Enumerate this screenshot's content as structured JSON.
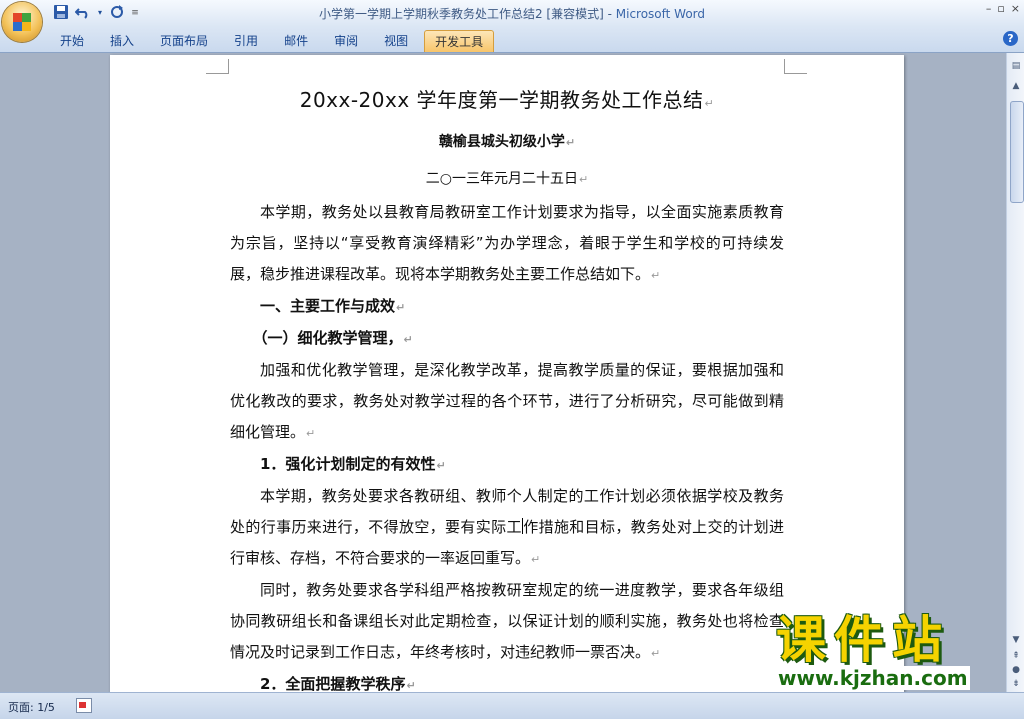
{
  "window": {
    "title": "小学第一学期上学期秋季教务处工作总结2 [兼容模式] - ",
    "app_name": "Microsoft Word",
    "controls": [
      "–",
      "▫",
      "×"
    ]
  },
  "ribbon": {
    "tabs": [
      {
        "label": "开始"
      },
      {
        "label": "插入"
      },
      {
        "label": "页面布局"
      },
      {
        "label": "引用"
      },
      {
        "label": "邮件"
      },
      {
        "label": "审阅"
      },
      {
        "label": "视图"
      },
      {
        "label": "开发工具",
        "active": true
      }
    ],
    "help_label": "?"
  },
  "quick_access": {
    "save_icon": "save-icon",
    "undo_icon": "undo-icon",
    "redo_icon": "redo-icon"
  },
  "document": {
    "title": "20xx-20xx 学年度第一学期教务处工作总结",
    "school": "赣榆县城头初级小学",
    "date": "二○一三年元月二十五日",
    "para1": "本学期，教务处以县教育局教研室工作计划要求为指导，以全面实施素质教育为宗旨，坚持以“享受教育演绎精彩”为办学理念，着眼于学生和学校的可持续发展，稳步推进课程改革。现将本学期教务处主要工作总结如下。",
    "heading1": "一、主要工作与成效",
    "heading2": "（一）细化教学管理，",
    "para2": "加强和优化教学管理，是深化教学改革，提高教学质量的保证，要根据加强和优化教改的要求，教务处对教学过程的各个环节，进行了分析研究，尽可能做到精细化管理。",
    "heading3": "1．强化计划制定的有效性",
    "para3a": "本学期，教务处要求各教研组、教师个人制定的工作计划必须依据学校及教务处的行事历来进行，不得放空，要有实际工",
    "para3b": "作措施和目标，教务处对上交的计划进行审核、存档，不符合要求的一率返回重写。",
    "para4": "同时，教务处要求各学科组严格按教研室规定的统一进度教学，要求各年级组协同教研组长和备课组长对此定期检查，以保证计划的顺利实施，教务处也将检查情况及时记录到工作日志，年终考核时，对违纪教师一票否决。",
    "heading4": "2．全面把握教学秩序",
    "para_mark": "↵"
  },
  "status": {
    "page": "页面: 1/5"
  },
  "watermark": {
    "text": "课件站",
    "url": "www.kjzhan.com"
  },
  "colors": {
    "accent": "#15428b",
    "active_tab": "#f8c56a",
    "watermark_yellow": "#f5d300",
    "watermark_green": "#1a6d10"
  }
}
